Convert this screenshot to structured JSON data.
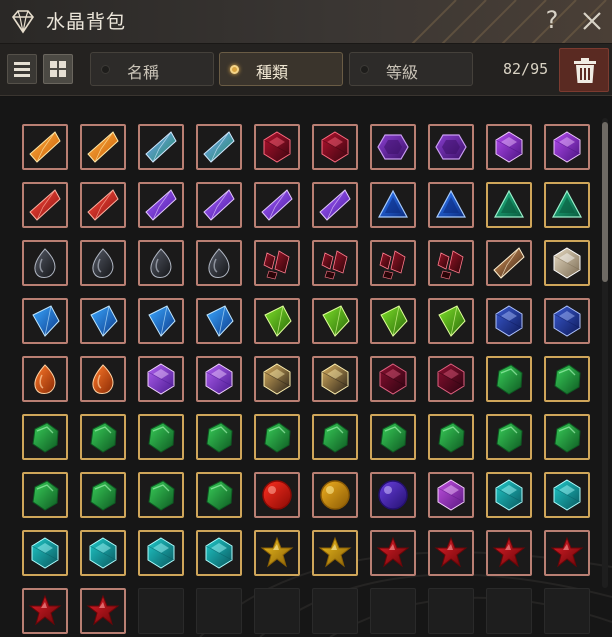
{
  "window": {
    "title": "水晶背包",
    "title_icon": "diamond-icon",
    "help_label": "?",
    "close_icon": "close-icon"
  },
  "toolbar": {
    "view_modes": [
      {
        "name": "list-view",
        "icon": "list-icon",
        "active": false
      },
      {
        "name": "grid-view",
        "icon": "grid-icon",
        "active": true
      }
    ],
    "sort_options": [
      {
        "label": "名稱",
        "selected": false
      },
      {
        "label": "種類",
        "selected": true
      },
      {
        "label": "等級",
        "selected": false
      }
    ],
    "count": "82/95",
    "delete_icon": "trash-icon"
  },
  "grid": {
    "columns": 10,
    "rows": 9,
    "capacity": 95,
    "filled": 82,
    "items": [
      "orange-crystal",
      "orange-crystal",
      "blue-green-crystal",
      "blue-green-crystal",
      "dark-red-gem",
      "dark-red-gem",
      "purple-hexagon",
      "purple-hexagon",
      "purple-round-gem",
      "purple-round-gem",
      "red-shard",
      "red-shard",
      "violet-shard",
      "violet-shard",
      "violet-shard",
      "violet-shard",
      "blue-triangle",
      "blue-triangle",
      "green-triangle",
      "green-triangle",
      "dark-teardrop",
      "dark-teardrop",
      "dark-teardrop",
      "dark-teardrop",
      "dark-ruby-cluster",
      "dark-ruby-cluster",
      "dark-ruby-cluster",
      "dark-ruby-cluster",
      "amber-shard",
      "white-gem",
      "blue-kite",
      "blue-kite",
      "blue-kite",
      "blue-kite",
      "green-kite",
      "green-kite",
      "green-kite",
      "green-kite",
      "navy-gem",
      "navy-gem",
      "orange-teardrop",
      "orange-teardrop",
      "purple-cut-gem",
      "purple-cut-gem",
      "gold-black-gem",
      "gold-black-gem",
      "crimson-gem",
      "crimson-gem",
      "emerald-rough",
      "emerald-rough",
      "emerald-rough",
      "emerald-rough",
      "emerald-rough",
      "emerald-rough",
      "emerald-rough",
      "emerald-rough",
      "emerald-rough",
      "emerald-rough",
      "emerald-rough",
      "emerald-rough",
      "emerald-rough",
      "emerald-rough",
      "emerald-rough",
      "emerald-rough",
      "red-sphere",
      "gold-sphere",
      "indigo-sphere",
      "purple-faceted",
      "teal-faceted",
      "teal-faceted",
      "teal-faceted",
      "teal-faceted",
      "teal-faceted",
      "teal-faceted",
      "gold-star",
      "gold-star",
      "red-star",
      "red-star",
      "red-star",
      "red-star",
      "red-star",
      "red-star"
    ]
  },
  "colors": {
    "slot_border": "#b97f73",
    "slot_border_gold": "#cfa65a",
    "accent_gold": "#d9a441",
    "delete_button": "#5a2a22"
  }
}
